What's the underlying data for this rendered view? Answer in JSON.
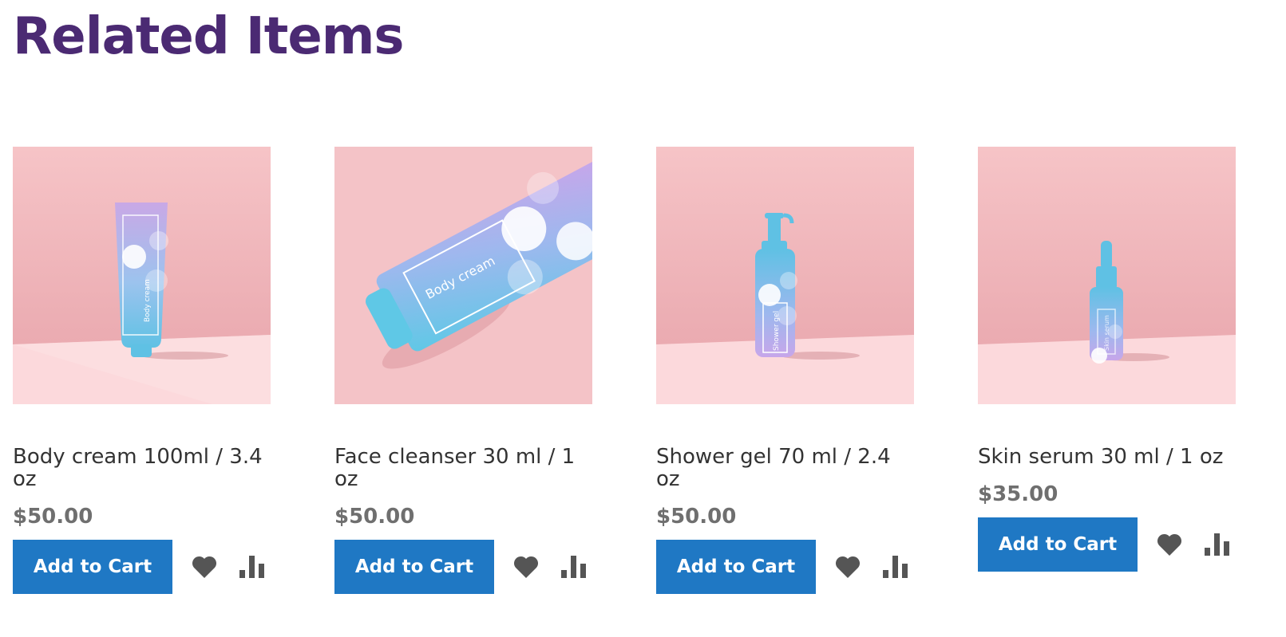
{
  "section": {
    "title": "Related Items"
  },
  "colors": {
    "title": "#4b2a73",
    "button": "#1f78c4",
    "price": "#6f6f6f",
    "icon": "#555555"
  },
  "products": [
    {
      "name": "Body cream 100ml / 3.4 oz",
      "price": "$50.00",
      "add_to_cart": "Add to Cart",
      "image_label": "Body cream"
    },
    {
      "name": "Face cleanser 30 ml / 1 oz",
      "price": "$50.00",
      "add_to_cart": "Add to Cart",
      "image_label": "Body cream"
    },
    {
      "name": "Shower gel 70 ml / 2.4 oz",
      "price": "$50.00",
      "add_to_cart": "Add to Cart",
      "image_label": "Shower gel"
    },
    {
      "name": "Skin serum 30 ml / 1 oz",
      "price": "$35.00",
      "add_to_cart": "Add to Cart",
      "image_label": "Skin serum"
    }
  ]
}
